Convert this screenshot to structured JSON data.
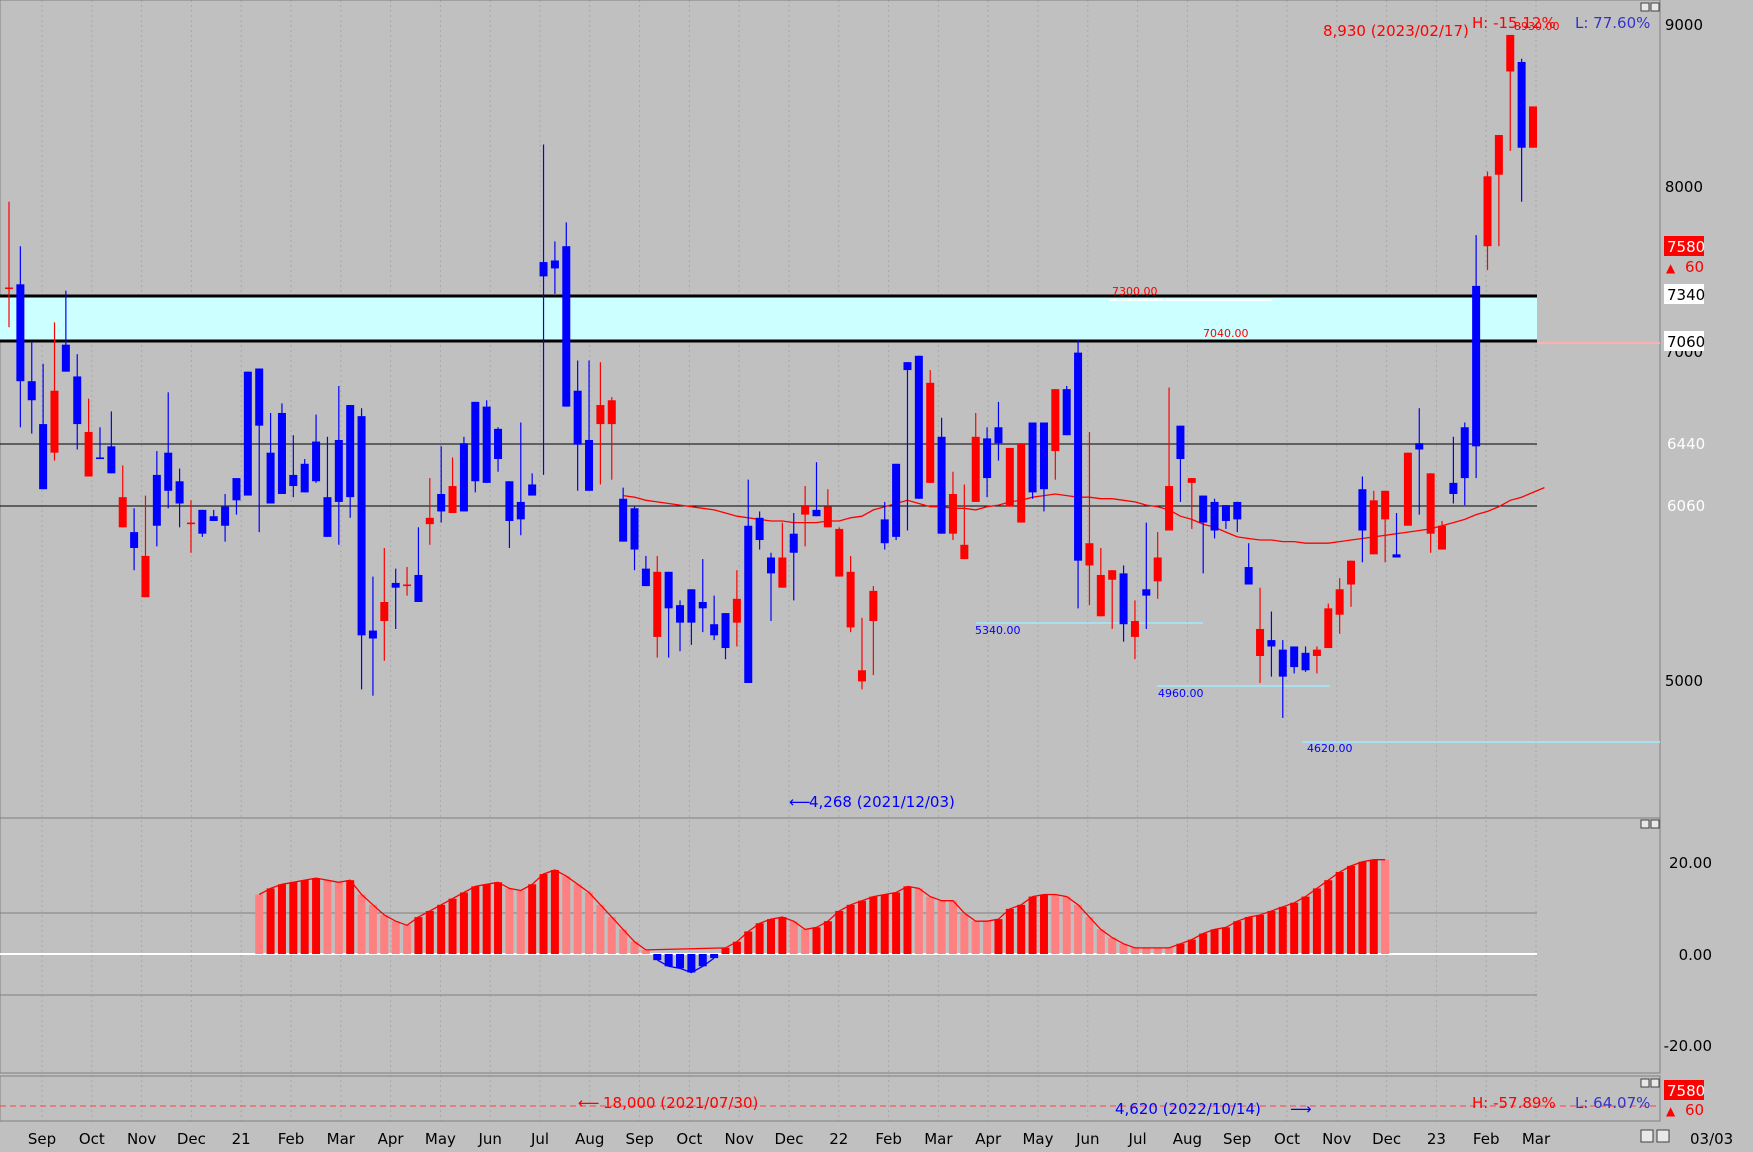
{
  "chart_data": [
    {
      "type": "candlestick",
      "title": "",
      "ylim": [
        4000,
        9150
      ],
      "y_ticks": [
        "9000",
        "8000",
        "7000",
        "5000"
      ],
      "x_tick_labels": [
        "Sep",
        "Oct",
        "Nov",
        "Dec",
        "21",
        "Feb",
        "Mar",
        "Apr",
        "May",
        "Jun",
        "Jul",
        "Aug",
        "Sep",
        "Oct",
        "Nov",
        "Dec",
        "22",
        "Feb",
        "Mar",
        "Apr",
        "May",
        "Jun",
        "Jul",
        "Aug",
        "Sep",
        "Oct",
        "Nov",
        "Dec",
        "23",
        "Feb",
        "Mar"
      ],
      "corner_date": "03/03",
      "candles": [
        [
          7340,
          7340,
          7880,
          7090
        ],
        [
          7360,
          6750,
          7600,
          6460
        ],
        [
          6750,
          6630,
          7000,
          6420
        ],
        [
          6480,
          6070,
          6860,
          6330
        ],
        [
          6300,
          6690,
          7120,
          6250
        ],
        [
          6980,
          6810,
          7320,
          6890
        ],
        [
          6780,
          6480,
          6920,
          6320
        ],
        [
          6150,
          6430,
          6640,
          6220
        ],
        [
          6270,
          6260,
          6460,
          6260
        ],
        [
          6340,
          6170,
          6560,
          6190
        ],
        [
          5830,
          6020,
          6220,
          5900
        ],
        [
          5800,
          5700,
          5950,
          5560
        ],
        [
          5390,
          5650,
          6030,
          5490
        ],
        [
          6160,
          5840,
          6310,
          5710
        ],
        [
          6300,
          6060,
          6680,
          5950
        ],
        [
          6120,
          5980,
          6200,
          5830
        ],
        [
          5850,
          5860,
          6000,
          5670
        ],
        [
          5940,
          5790,
          5800,
          5770
        ],
        [
          5900,
          5870,
          5940,
          5910
        ],
        [
          5960,
          5840,
          6040,
          5740
        ],
        [
          6140,
          6000,
          6090,
          5910
        ],
        [
          6810,
          6030,
          6670,
          6030
        ],
        [
          6830,
          6470,
          6810,
          5800
        ],
        [
          6300,
          5980,
          6550,
          6430
        ],
        [
          6550,
          6040,
          6610,
          6110
        ],
        [
          6160,
          6090,
          6410,
          6020
        ],
        [
          6230,
          6050,
          6260,
          6110
        ],
        [
          6370,
          6120,
          6540,
          6110
        ],
        [
          6020,
          5770,
          6400,
          5900
        ],
        [
          6380,
          5990,
          6720,
          5720
        ],
        [
          6600,
          6020,
          6420,
          5890
        ],
        [
          6530,
          5150,
          6580,
          4810
        ],
        [
          5180,
          5130,
          5520,
          4770
        ],
        [
          5240,
          5360,
          5700,
          4990
        ],
        [
          5480,
          5450,
          5570,
          5190
        ],
        [
          5460,
          5470,
          5580,
          5400
        ],
        [
          5530,
          5360,
          5830,
          5470
        ],
        [
          5850,
          5890,
          6140,
          5720
        ],
        [
          6040,
          5930,
          6340,
          5860
        ],
        [
          5920,
          6090,
          6270,
          6030
        ],
        [
          6360,
          5930,
          6400,
          6000
        ],
        [
          6620,
          6120,
          6570,
          6050
        ],
        [
          6590,
          6110,
          6630,
          6200
        ],
        [
          6450,
          6260,
          6460,
          6180
        ],
        [
          6120,
          5870,
          6010,
          5700
        ],
        [
          5990,
          5880,
          6490,
          5780
        ],
        [
          6100,
          6030,
          6170,
          6080
        ],
        [
          7500,
          7410,
          8240,
          6160
        ],
        [
          7510,
          7460,
          7630,
          7300
        ],
        [
          7600,
          6590,
          7750,
          6990
        ],
        [
          6690,
          6350,
          6880,
          6060
        ],
        [
          6380,
          6060,
          6880,
          6390
        ],
        [
          6480,
          6600,
          6870,
          6100
        ],
        [
          6480,
          6630,
          6650,
          6130
        ],
        [
          6010,
          5740,
          6080,
          5790
        ],
        [
          5950,
          5690,
          5960,
          5560
        ],
        [
          5570,
          5460,
          5650,
          5490
        ],
        [
          5140,
          5550,
          5650,
          5010
        ],
        [
          5550,
          5320,
          5370,
          5010
        ],
        [
          5340,
          5230,
          5370,
          5050
        ],
        [
          5440,
          5230,
          5320,
          5090
        ],
        [
          5360,
          5320,
          5630,
          5170
        ],
        [
          5220,
          5150,
          5400,
          5120
        ],
        [
          5290,
          5070,
          5250,
          5000
        ],
        [
          5230,
          5380,
          5560,
          5080
        ],
        [
          5840,
          4850,
          6130,
          4880
        ],
        [
          5890,
          5750,
          5930,
          5690
        ],
        [
          5640,
          5540,
          5670,
          5240
        ],
        [
          5450,
          5640,
          5860,
          5470
        ],
        [
          5790,
          5670,
          5920,
          5370
        ],
        [
          5910,
          5970,
          6090,
          5710
        ],
        [
          5940,
          5900,
          6240,
          6000
        ],
        [
          5830,
          5960,
          6070,
          5850
        ],
        [
          5520,
          5820,
          5830,
          5560
        ],
        [
          5200,
          5550,
          5650,
          5170
        ],
        [
          4860,
          4930,
          5260,
          4810
        ],
        [
          5240,
          5430,
          5460,
          4900
        ],
        [
          5880,
          5730,
          5990,
          5690
        ],
        [
          6230,
          5770,
          6160,
          5750
        ],
        [
          6870,
          6820,
          6390,
          5810
        ],
        [
          6910,
          6010,
          6840,
          6010
        ],
        [
          6110,
          6740,
          6820,
          6400
        ],
        [
          6400,
          5790,
          6520,
          5810
        ],
        [
          5790,
          6040,
          6180,
          5750
        ],
        [
          5630,
          5720,
          6100,
          5640
        ],
        [
          5990,
          6400,
          6550,
          6030
        ],
        [
          6390,
          6140,
          6460,
          6020
        ],
        [
          6460,
          6360,
          6620,
          6250
        ],
        [
          5960,
          6330,
          6310,
          6070
        ],
        [
          5860,
          6360,
          6290,
          6060
        ],
        [
          6490,
          6050,
          6260,
          6010
        ],
        [
          6490,
          6070,
          6440,
          5930
        ],
        [
          6310,
          6700,
          6630,
          6130
        ],
        [
          6700,
          6410,
          6720,
          6770
        ],
        [
          6930,
          5620,
          7010,
          5320
        ],
        [
          5590,
          5730,
          6430,
          5340
        ],
        [
          5270,
          5530,
          5700,
          5390
        ],
        [
          5500,
          5560,
          5520,
          5190
        ],
        [
          5540,
          5220,
          5590,
          5110
        ],
        [
          5140,
          5240,
          5370,
          5000
        ],
        [
          5440,
          5400,
          5860,
          5190
        ],
        [
          5490,
          5640,
          5800,
          5380
        ],
        [
          5810,
          6090,
          6710,
          5870
        ],
        [
          6470,
          6260,
          6200,
          5990
        ],
        [
          6110,
          6140,
          6130,
          5820
        ],
        [
          6030,
          5860,
          6000,
          5540
        ],
        [
          5990,
          5810,
          6010,
          5760
        ],
        [
          5970,
          5870,
          5930,
          5820
        ],
        [
          5990,
          5880,
          5970,
          5800
        ],
        [
          5580,
          5470,
          5730,
          5470
        ],
        [
          5020,
          5190,
          5450,
          4850
        ],
        [
          5120,
          5080,
          5300,
          4890
        ],
        [
          5060,
          4890,
          5120,
          4630
        ],
        [
          5080,
          4950,
          5040,
          4910
        ],
        [
          5040,
          4930,
          5080,
          4920
        ],
        [
          5020,
          5060,
          5080,
          4910
        ],
        [
          5070,
          5320,
          5350,
          5080
        ],
        [
          5280,
          5440,
          5510,
          5160
        ],
        [
          5470,
          5620,
          5570,
          5330
        ],
        [
          6070,
          5810,
          6150,
          5610
        ],
        [
          5660,
          6000,
          6060,
          5870
        ],
        [
          5880,
          6060,
          6030,
          5610
        ],
        [
          5660,
          5640,
          5920,
          5840
        ],
        [
          5840,
          6300,
          6270,
          5910
        ],
        [
          6360,
          6320,
          6580,
          5910
        ],
        [
          5790,
          6170,
          5830,
          5670
        ],
        [
          5690,
          5840,
          5870,
          5690
        ],
        [
          6110,
          6040,
          6400,
          5980
        ],
        [
          6460,
          6140,
          6490,
          5970
        ],
        [
          7350,
          6340,
          7670,
          6140
        ],
        [
          7600,
          8040,
          8070,
          7450
        ],
        [
          8050,
          8300,
          8290,
          7600
        ],
        [
          8700,
          8930,
          8930,
          8200
        ],
        [
          8760,
          8220,
          8780,
          7880
        ],
        [
          8220,
          8480,
          8290,
          8290
        ]
      ],
      "ma_line": [
        null,
        null,
        null,
        null,
        null,
        null,
        null,
        null,
        null,
        null,
        null,
        null,
        null,
        null,
        null,
        null,
        null,
        null,
        null,
        null,
        null,
        null,
        null,
        null,
        null,
        null,
        null,
        null,
        null,
        null,
        null,
        null,
        null,
        null,
        null,
        null,
        null,
        null,
        null,
        null,
        null,
        null,
        null,
        null,
        null,
        null,
        null,
        null,
        null,
        null,
        null,
        null,
        null,
        null,
        6030,
        6020,
        6000,
        5990,
        5980,
        5970,
        5960,
        5950,
        5940,
        5920,
        5900,
        5890,
        5880,
        5870,
        5870,
        5860,
        5860,
        5860,
        5870,
        5870,
        5890,
        5900,
        5940,
        5960,
        5980,
        6000,
        5980,
        5960,
        5960,
        5950,
        5950,
        5940,
        5960,
        5970,
        5990,
        6000,
        6020,
        6030,
        6040,
        6030,
        6020,
        6020,
        6010,
        6010,
        6000,
        5990,
        5970,
        5960,
        5940,
        5900,
        5880,
        5850,
        5830,
        5800,
        5770,
        5760,
        5750,
        5750,
        5740,
        5740,
        5730,
        5730,
        5730,
        5740,
        5750,
        5760,
        5770,
        5780,
        5790,
        5800,
        5810,
        5820,
        5840,
        5860,
        5880,
        5910,
        5930,
        5960,
        6000,
        6020,
        6050,
        6080
      ],
      "price_labels": {
        "last": "7580",
        "last_change": "60",
        "zone_top": "7340",
        "zone_bottom": "7060",
        "level_1": "6440",
        "level_2": "6060"
      },
      "hi_marker": "8,930 (2023/02/17)",
      "hi_bar_label": "8930.00",
      "hi_stats": "H: -15.12%",
      "lo_stats": "L: 77.60%",
      "low_marker": "4,268 (2021/12/03)",
      "annotations": [
        "7300.00",
        "7040.00",
        "5340.00",
        "4960.00",
        "4620.00"
      ]
    },
    {
      "type": "bar",
      "title": "",
      "ylim": [
        -25,
        25
      ],
      "y_ticks": [
        "20.00",
        "0.00",
        "-20.00"
      ],
      "series": [
        {
          "values": [
            null,
            null,
            null,
            null,
            null,
            null,
            null,
            null,
            null,
            null,
            null,
            null,
            null,
            null,
            null,
            null,
            null,
            null,
            null,
            null,
            null,
            null,
            14.5,
            16.0,
            17.0,
            17.5,
            18.0,
            18.5,
            18.0,
            17.5,
            18.0,
            14.5,
            12.0,
            9.5,
            8.0,
            7.0,
            9.0,
            10.5,
            12.0,
            13.5,
            15.0,
            16.5,
            17.0,
            17.5,
            16.0,
            15.5,
            17.0,
            19.5,
            20.5,
            19.0,
            17.0,
            15.0,
            12.0,
            9.0,
            6.0,
            3.0,
            1.0,
            -1.5,
            -3.0,
            -3.5,
            -4.5,
            -3.0,
            -1.0,
            1.5,
            3.0,
            5.5,
            7.5,
            8.5,
            9.0,
            8.0,
            6.0,
            6.5,
            8.0,
            10.5,
            12.0,
            13.0,
            14.0,
            14.5,
            15.0,
            16.5,
            16.0,
            14.0,
            13.0,
            13.0,
            10.0,
            8.0,
            8.0,
            8.5,
            11.0,
            12.0,
            14.0,
            14.5,
            14.5,
            14.0,
            12.0,
            9.0,
            6.0,
            4.0,
            2.5,
            1.5,
            1.5,
            1.5,
            1.5,
            2.5,
            3.5,
            5.0,
            6.0,
            6.5,
            8.0,
            9.0,
            9.5,
            10.5,
            11.5,
            12.5,
            14.0,
            16.0,
            18.0,
            20.0,
            21.5,
            22.5,
            23.0,
            23.0
          ]
        }
      ]
    }
  ],
  "bottom_panel": {
    "left_marker": "18,000 (2021/07/30)",
    "mid_marker": "4,620 (2022/10/14)",
    "stats_h": "H: -57.89%",
    "stats_l": "L: 64.07%",
    "last": "7580",
    "last_change": "60"
  },
  "colors": {
    "background": "#c0c0c0",
    "up": "#ff0000",
    "down": "#0000ff",
    "zone": "#ccffff",
    "histogram_up_light": "#ff8080",
    "histogram_up": "#ff0000",
    "histogram_down": "#0000ff"
  }
}
